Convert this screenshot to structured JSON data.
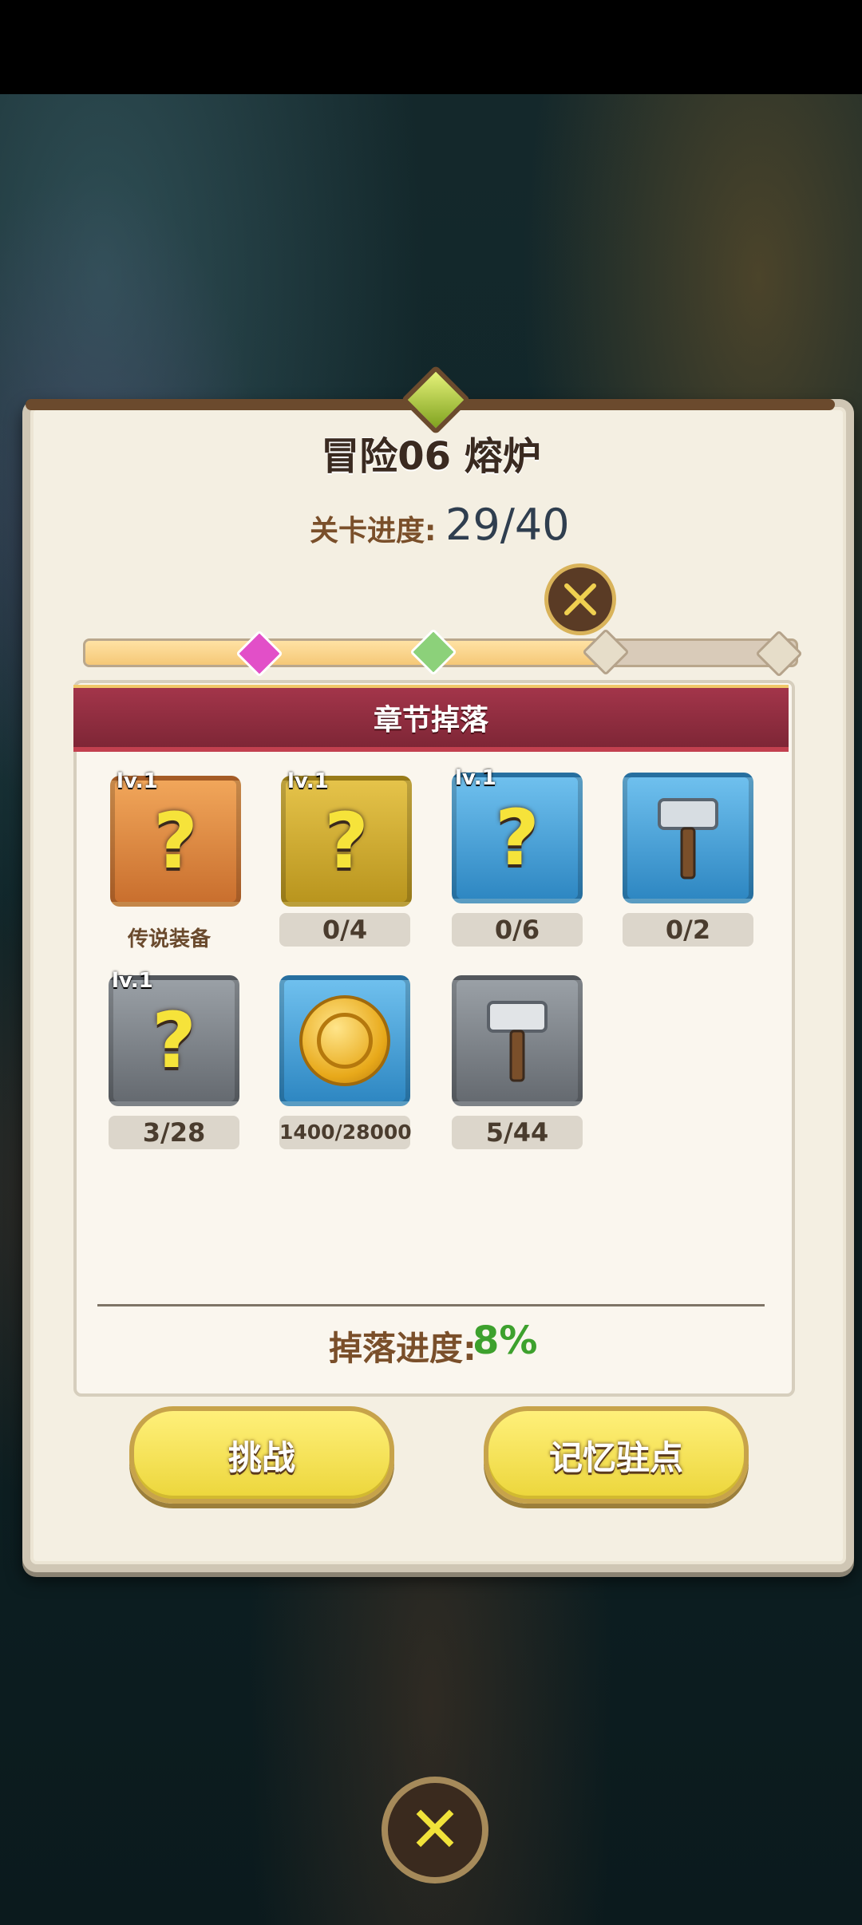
{
  "dialog": {
    "title": "冒险06 熔炉",
    "stage_progress_label": "关卡进度:",
    "stage_progress_value": "29/40",
    "stage_progress_fraction": 0.725,
    "section_title": "章节掉落",
    "drop_progress_label": "掉落进度:",
    "drop_progress_value": "8%"
  },
  "drops": [
    {
      "level": "lv.1",
      "frame": "orange",
      "icon": "mystery-helmet-icon",
      "caption": "传说装备"
    },
    {
      "level": "lv.1",
      "frame": "gold",
      "icon": "mystery-helmet-icon",
      "count": "0/4"
    },
    {
      "level": "lv.1",
      "frame": "blue",
      "icon": "mystery-helmet-icon",
      "count": "0/6"
    },
    {
      "frame": "blue",
      "icon": "hammer-icon",
      "count": "0/2"
    },
    {
      "level": "lv.1",
      "frame": "gray",
      "icon": "mystery-helmet-icon",
      "count": "3/28"
    },
    {
      "frame": "blue",
      "icon": "gold-coin-icon",
      "count": "1400/28000"
    },
    {
      "frame": "gray",
      "icon": "hammer-icon",
      "count": "5/44"
    }
  ],
  "buttons": {
    "challenge": "挑战",
    "memory_outpost": "记忆驻点"
  },
  "colors": {
    "ribbon": "#8e2b3f",
    "button_yellow": "#f5e35a",
    "drop_percent": "#3da12d",
    "stage_value": "#2f3e4f"
  }
}
